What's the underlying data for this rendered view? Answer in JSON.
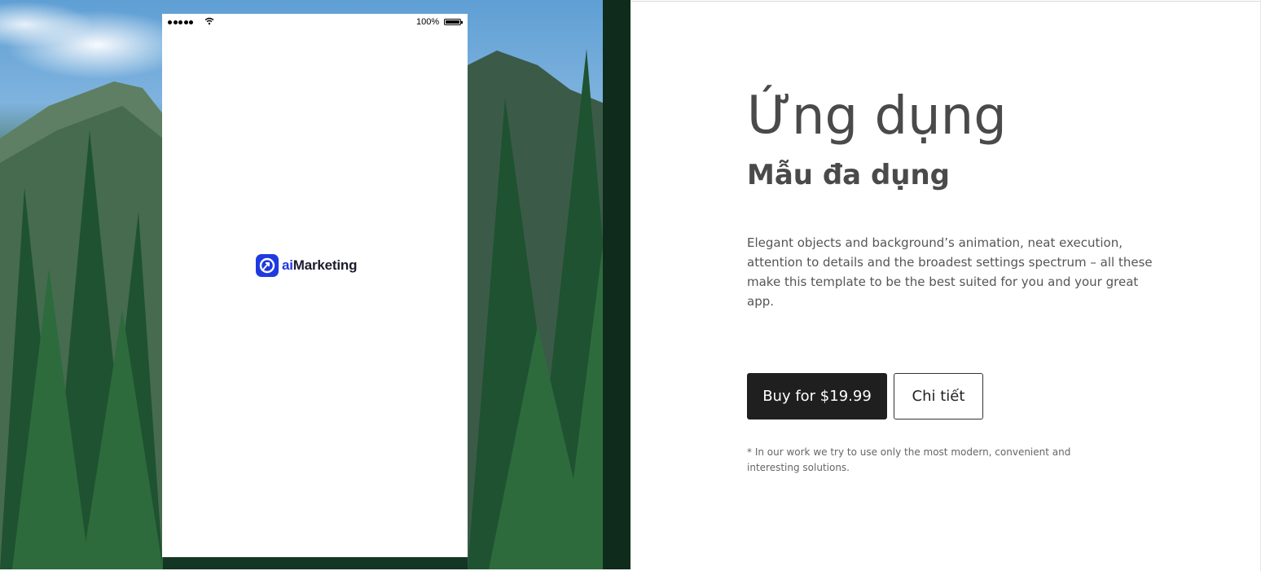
{
  "colors": {
    "accent": "#1f3ae0",
    "buy_button_bg": "#1f1f1f",
    "heading_text": "#4a4a4a",
    "body_text": "#555555"
  },
  "phone": {
    "status_bar": {
      "signal_icon": "signal-dots-icon",
      "wifi_icon": "wifi-icon",
      "battery_text": "100%",
      "battery_icon": "battery-full-icon"
    },
    "logo": {
      "icon": "aimarketing-logo-icon",
      "text_prefix": "ai",
      "text_suffix": "Marketing"
    }
  },
  "hero": {
    "title": "Ứng dụng",
    "subtitle": "Mẫu đa dụng",
    "description": "Elegant objects and background’s animation, neat execution, attention to details and the broadest settings spectrum – all these make this template to be the best suited for you and your great app.",
    "buy_button": "Buy for $19.99",
    "detail_button": "Chi tiết",
    "note": "* In our work we try to use only the most modern, convenient and interesting solutions."
  }
}
